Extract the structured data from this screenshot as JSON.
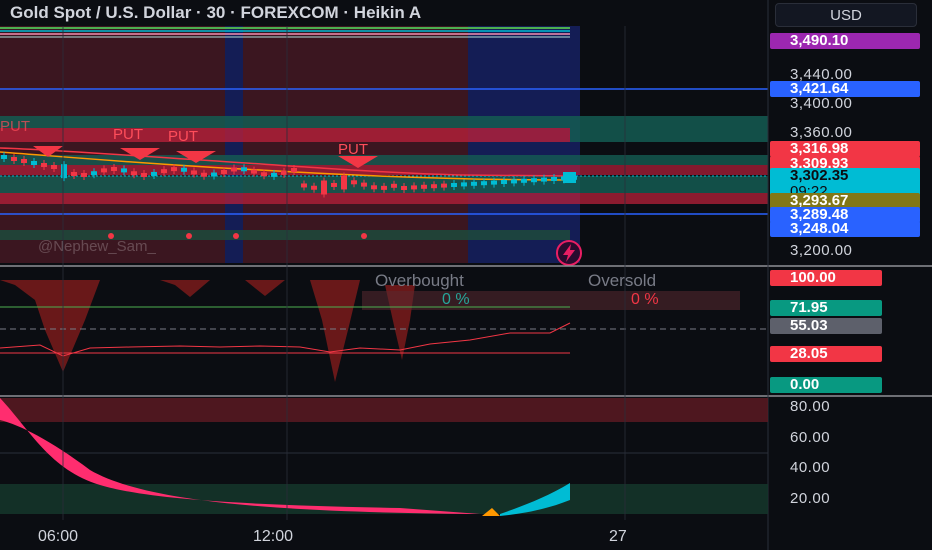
{
  "header": {
    "title": "Gold Spot / U.S. Dollar · 30 · FOREXCOM · Heikin A",
    "currency_button": "USD"
  },
  "price_axis": {
    "ticks": [
      "3,440.00",
      "3,400.00",
      "3,360.00",
      "3,200.00"
    ],
    "tags": [
      {
        "label": "3,490.10",
        "color": "#9c27b0",
        "text_color": "#ffffff"
      },
      {
        "label": "3,421.64",
        "color": "#2962ff",
        "text_color": "#ffffff"
      },
      {
        "label": "3,316.98",
        "color": "#f23645",
        "text_color": "#ffffff"
      },
      {
        "label": "3,309.93",
        "color": "#f23645",
        "text_color": "#ffffff"
      },
      {
        "label": "3,302.35",
        "sublabel": "09:22",
        "color": "#00bcd4",
        "text_color": "#0b0d12"
      },
      {
        "label": "3,293.67",
        "color": "#827717",
        "text_color": "#ffffff"
      },
      {
        "label": "3,289.48",
        "color": "#2962ff",
        "text_color": "#ffffff"
      },
      {
        "label": "3,248.04",
        "color": "#2962ff",
        "text_color": "#ffffff"
      }
    ]
  },
  "main_chart": {
    "signals": [
      "PUT",
      "PUT",
      "PUT",
      "PUT"
    ],
    "watermark": "@Nephew_Sam_"
  },
  "oscillator": {
    "overbought_label": "Overbought",
    "oversold_label": "Oversold",
    "overbought_value": "0 %",
    "oversold_value": "0 %",
    "tags": [
      {
        "label": "100.00",
        "color": "#f23645",
        "text_color": "#ffffff"
      },
      {
        "label": "71.95",
        "color": "#089981",
        "text_color": "#ffffff"
      },
      {
        "label": "55.03",
        "color": "#5d606b",
        "text_color": "#ffffff"
      },
      {
        "label": "28.05",
        "color": "#f23645",
        "text_color": "#ffffff"
      },
      {
        "label": "0.00",
        "color": "#089981",
        "text_color": "#ffffff"
      }
    ]
  },
  "bottom_panel": {
    "ticks": [
      "80.00",
      "60.00",
      "40.00",
      "20.00"
    ]
  },
  "time_axis": {
    "labels": [
      "06:00",
      "12:00",
      "27"
    ]
  },
  "colors": {
    "background": "#0b0d12",
    "bull": "#00bcd4",
    "bear": "#f23645",
    "session_red": "#4a1a22",
    "session_blue": "#141e5a"
  }
}
